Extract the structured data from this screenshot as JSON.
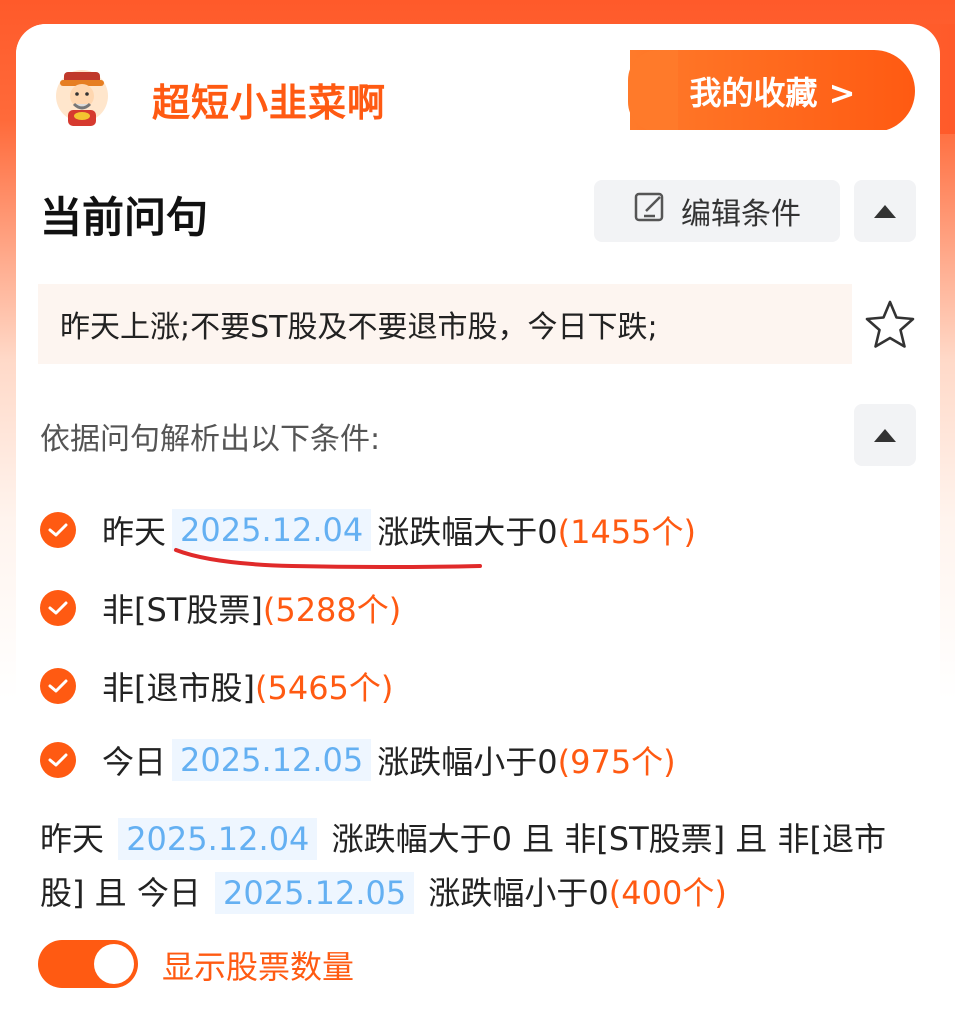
{
  "header": {
    "brand": "超短小韭菜啊",
    "favorites_button": "我的收藏 >"
  },
  "query_section": {
    "title": "当前问句",
    "edit_label": "编辑条件",
    "query_text": "昨天上涨;不要ST股及不要退市股，今日下跌;",
    "basis_label": "依据问句解析出以下条件:"
  },
  "conditions": [
    {
      "pre": "昨天",
      "date": "2025.12.04",
      "post": "涨跌幅大于0",
      "count": "(1455个)"
    },
    {
      "pre": "非[ST股票]",
      "date": "",
      "post": "",
      "count": "(5288个)"
    },
    {
      "pre": "非[退市股]",
      "date": "",
      "post": "",
      "count": "(5465个)"
    },
    {
      "pre": "今日",
      "date": "2025.12.05",
      "post": "涨跌幅小于0",
      "count": "(975个)"
    }
  ],
  "summary": {
    "p1": "昨天",
    "d1": "2025.12.04",
    "p2": "涨跌幅大于0 且 非[ST股票] 且 非[退市股] 且 今日",
    "d2": "2025.12.05",
    "p3": "涨跌幅小于0",
    "count": "(400个)"
  },
  "toggle": {
    "label": "显示股票数量",
    "on": true
  },
  "colors": {
    "accent": "#ff5a12",
    "date_text": "#64b0f2",
    "date_bg": "#eef6ff"
  },
  "icons": [
    "avatar-icon",
    "edit-icon",
    "collapse-up-icon",
    "star-icon",
    "check-icon"
  ]
}
